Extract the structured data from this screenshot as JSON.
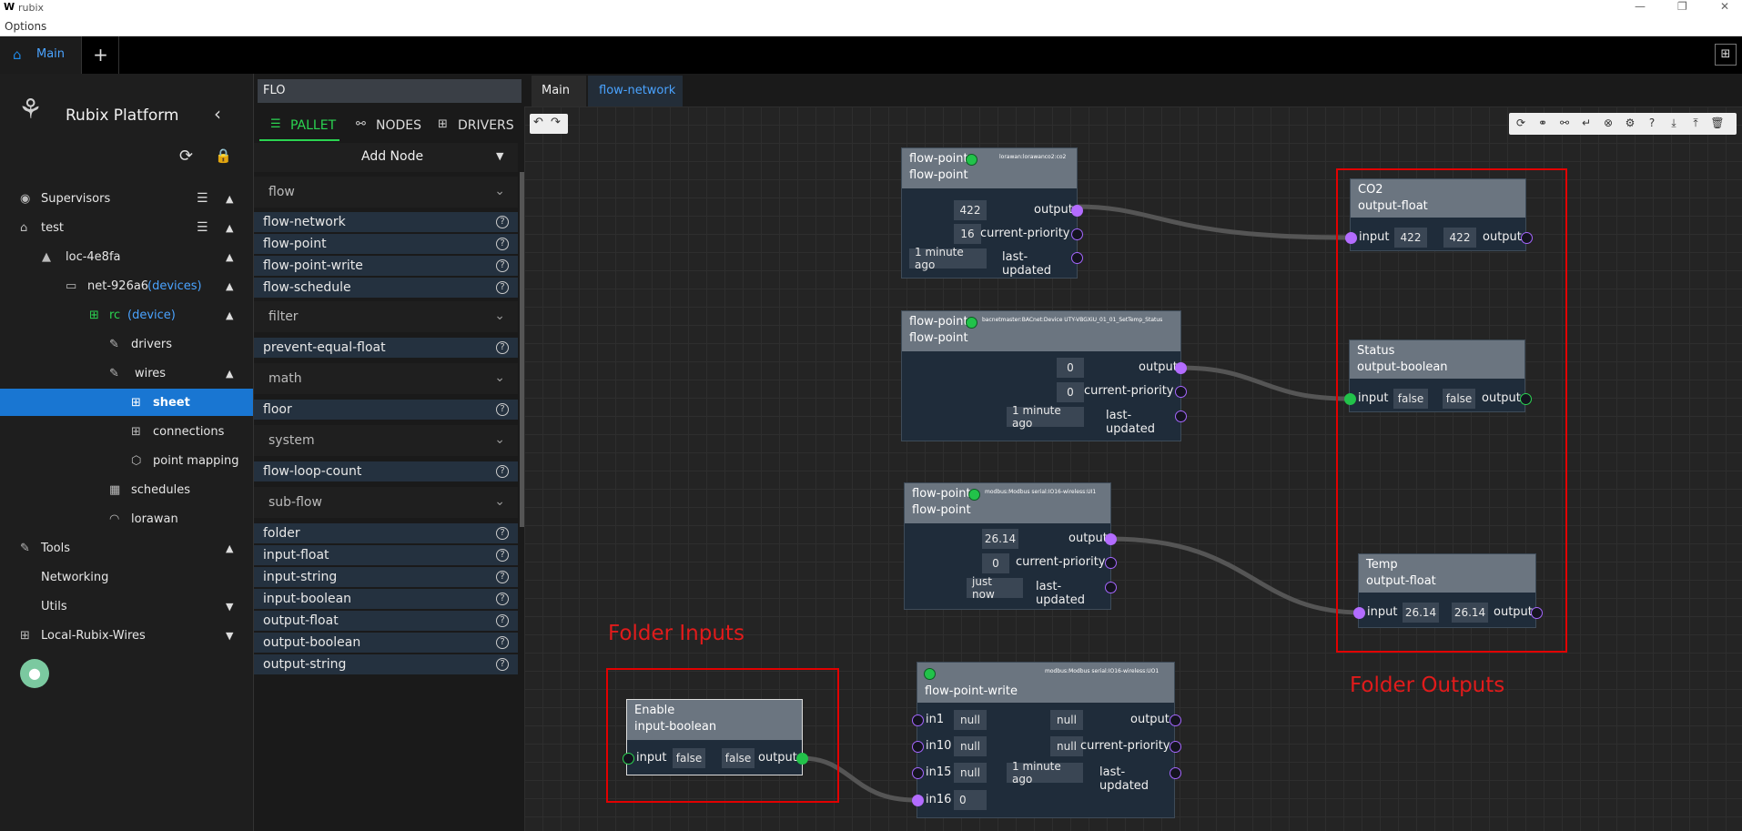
{
  "window": {
    "app_title": "rubix",
    "menu_options": "Options"
  },
  "tabs": {
    "main_label": "Main",
    "add_label": "+"
  },
  "sidebar": {
    "brand": "Rubix Platform",
    "supervisors": "Supervisors",
    "test": "test",
    "loc": "loc-4e8fa",
    "net": "net-926a6",
    "net_tag": "(devices)",
    "rc": "rc",
    "rc_tag": "(device)",
    "drivers": "drivers",
    "wires": "wires",
    "sheet": "sheet",
    "connections": "connections",
    "point_mapping": "point mapping",
    "schedules": "schedules",
    "lorawan": "lorawan",
    "tools": "Tools",
    "networking": "Networking",
    "utils": "Utils",
    "local_wires": "Local-Rubix-Wires"
  },
  "pallet": {
    "search": "FLO",
    "tab_pallet": "PALLET",
    "tab_nodes": "NODES",
    "tab_drivers": "DRIVERS",
    "add_node": "Add Node",
    "groups": {
      "flow": "flow",
      "filter": "filter",
      "math": "math",
      "system": "system",
      "subflow": "sub-flow"
    },
    "items": {
      "flow_network": "flow-network",
      "flow_point": "flow-point",
      "flow_point_write": "flow-point-write",
      "flow_schedule": "flow-schedule",
      "prevent_equal_float": "prevent-equal-float",
      "floor": "floor",
      "flow_loop_count": "flow-loop-count",
      "folder": "folder",
      "input_float": "input-float",
      "input_string": "input-string",
      "input_boolean": "input-boolean",
      "output_float": "output-float",
      "output_boolean": "output-boolean",
      "output_string": "output-string"
    }
  },
  "canvas_tabs": {
    "main": "Main",
    "flow_network": "flow-network"
  },
  "nodes": {
    "fp1": {
      "title": "flow-point",
      "type": "flow-point",
      "source": "lorawan:lorawanco2:co2",
      "output": "422",
      "priority": "16",
      "updated": "1 minute ago"
    },
    "fp2": {
      "title": "flow-point",
      "type": "flow-point",
      "source": "bacnetmaster:BACnet:Device UTY-VBGXiU_01_01_SetTemp_Status",
      "output": "0",
      "priority": "0",
      "updated": "1 minute ago"
    },
    "fp3": {
      "title": "flow-point",
      "type": "flow-point",
      "source": "modbus:Modbus serial:IO16-wireless:UI1",
      "output": "26.14",
      "priority": "0",
      "updated": "just now"
    },
    "fpw": {
      "type": "flow-point-write",
      "source": "modbus:Modbus serial:IO16-wireless:UO1",
      "in1": "null",
      "in10": "null",
      "in15": "null",
      "in16": "0",
      "output": "null",
      "priority": "null",
      "updated": "1 minute ago"
    },
    "co2": {
      "name": "CO2",
      "type": "output-float",
      "in_val": "422",
      "out_val": "422"
    },
    "status": {
      "name": "Status",
      "type": "output-boolean",
      "in_val": "false",
      "out_val": "false"
    },
    "temp": {
      "name": "Temp",
      "type": "output-float",
      "in_val": "26.14",
      "out_val": "26.14"
    },
    "enable": {
      "name": "Enable",
      "type": "input-boolean",
      "in_val": "false",
      "out_val": "false"
    }
  },
  "labels": {
    "output": "output",
    "current_priority": "current-priority",
    "last_updated": "last-updated",
    "input": "input",
    "in1": "in1",
    "in10": "in10",
    "in15": "in15",
    "in16": "in16"
  },
  "annotations": {
    "folder_inputs": "Folder Inputs",
    "folder_outputs": "Folder Outputs"
  },
  "colors": {
    "accent": "#1976d2",
    "port_purple": "#b36cff",
    "port_green": "#22c24a",
    "annotation_red": "#e20000"
  }
}
